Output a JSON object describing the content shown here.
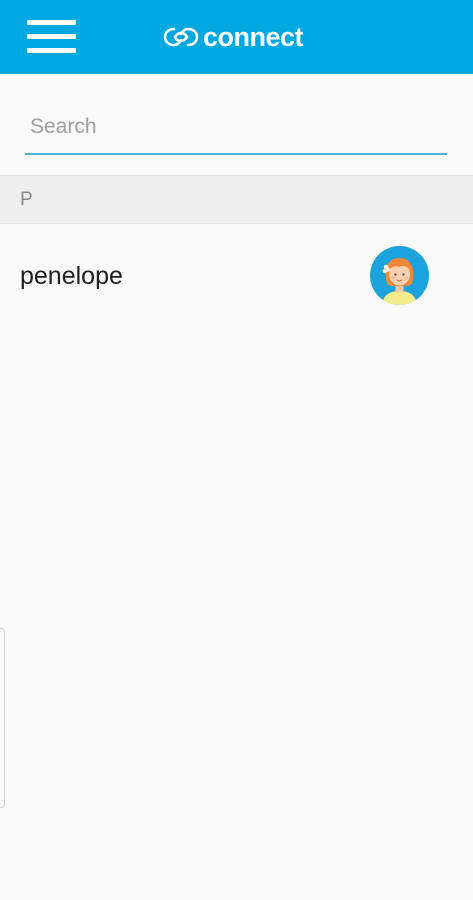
{
  "appbar": {
    "brand_name": "connect",
    "menu_icon": "hamburger-menu-icon",
    "logo_icon": "infinity-link-icon",
    "color": "#00a8e1"
  },
  "search": {
    "placeholder": "Search",
    "value": ""
  },
  "contacts": {
    "sections": [
      {
        "letter": "P",
        "items": [
          {
            "name": "penelope",
            "avatar_icon": "girl-avatar-icon"
          }
        ]
      }
    ]
  }
}
